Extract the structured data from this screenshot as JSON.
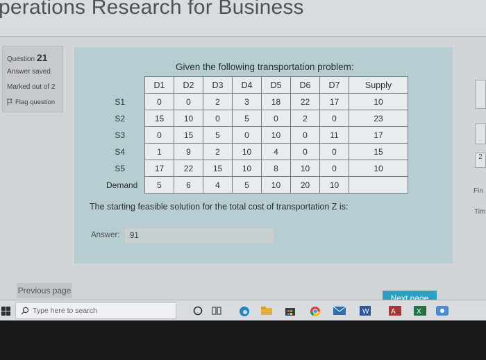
{
  "page": {
    "heading": "perations Research for Business"
  },
  "question_info": {
    "label": "Question",
    "number": "21",
    "status": "Answer saved",
    "marks": "Marked out of 2",
    "flag_label": "Flag question"
  },
  "question": {
    "title": "Given the following transportation problem:",
    "footnote": "The starting feasible solution for the total cost of transportation Z is:",
    "table": {
      "columns": [
        "D1",
        "D2",
        "D3",
        "D4",
        "D5",
        "D6",
        "D7"
      ],
      "supply_label": "Supply",
      "rows": [
        {
          "label": "S1",
          "costs": [
            "0",
            "0",
            "2",
            "3",
            "18",
            "22",
            "17"
          ],
          "supply": "10"
        },
        {
          "label": "S2",
          "costs": [
            "15",
            "10",
            "0",
            "5",
            "0",
            "2",
            "0"
          ],
          "supply": "23"
        },
        {
          "label": "S3",
          "costs": [
            "0",
            "15",
            "5",
            "0",
            "10",
            "0",
            "11"
          ],
          "supply": "17"
        },
        {
          "label": "S4",
          "costs": [
            "1",
            "9",
            "2",
            "10",
            "4",
            "0",
            "0"
          ],
          "supply": "15"
        },
        {
          "label": "S5",
          "costs": [
            "17",
            "22",
            "15",
            "10",
            "8",
            "10",
            "0"
          ],
          "supply": "10"
        }
      ],
      "demand_label": "Demand",
      "demand": [
        "5",
        "6",
        "4",
        "5",
        "10",
        "20",
        "10"
      ]
    }
  },
  "answer": {
    "label": "Answer:",
    "value": "91"
  },
  "navigation": {
    "prev": "Previous page",
    "next": "Next page"
  },
  "right_edge": {
    "text1": "Fin",
    "text2": "Tim",
    "box": "2"
  },
  "taskbar": {
    "search_placeholder": "Type here to search"
  }
}
